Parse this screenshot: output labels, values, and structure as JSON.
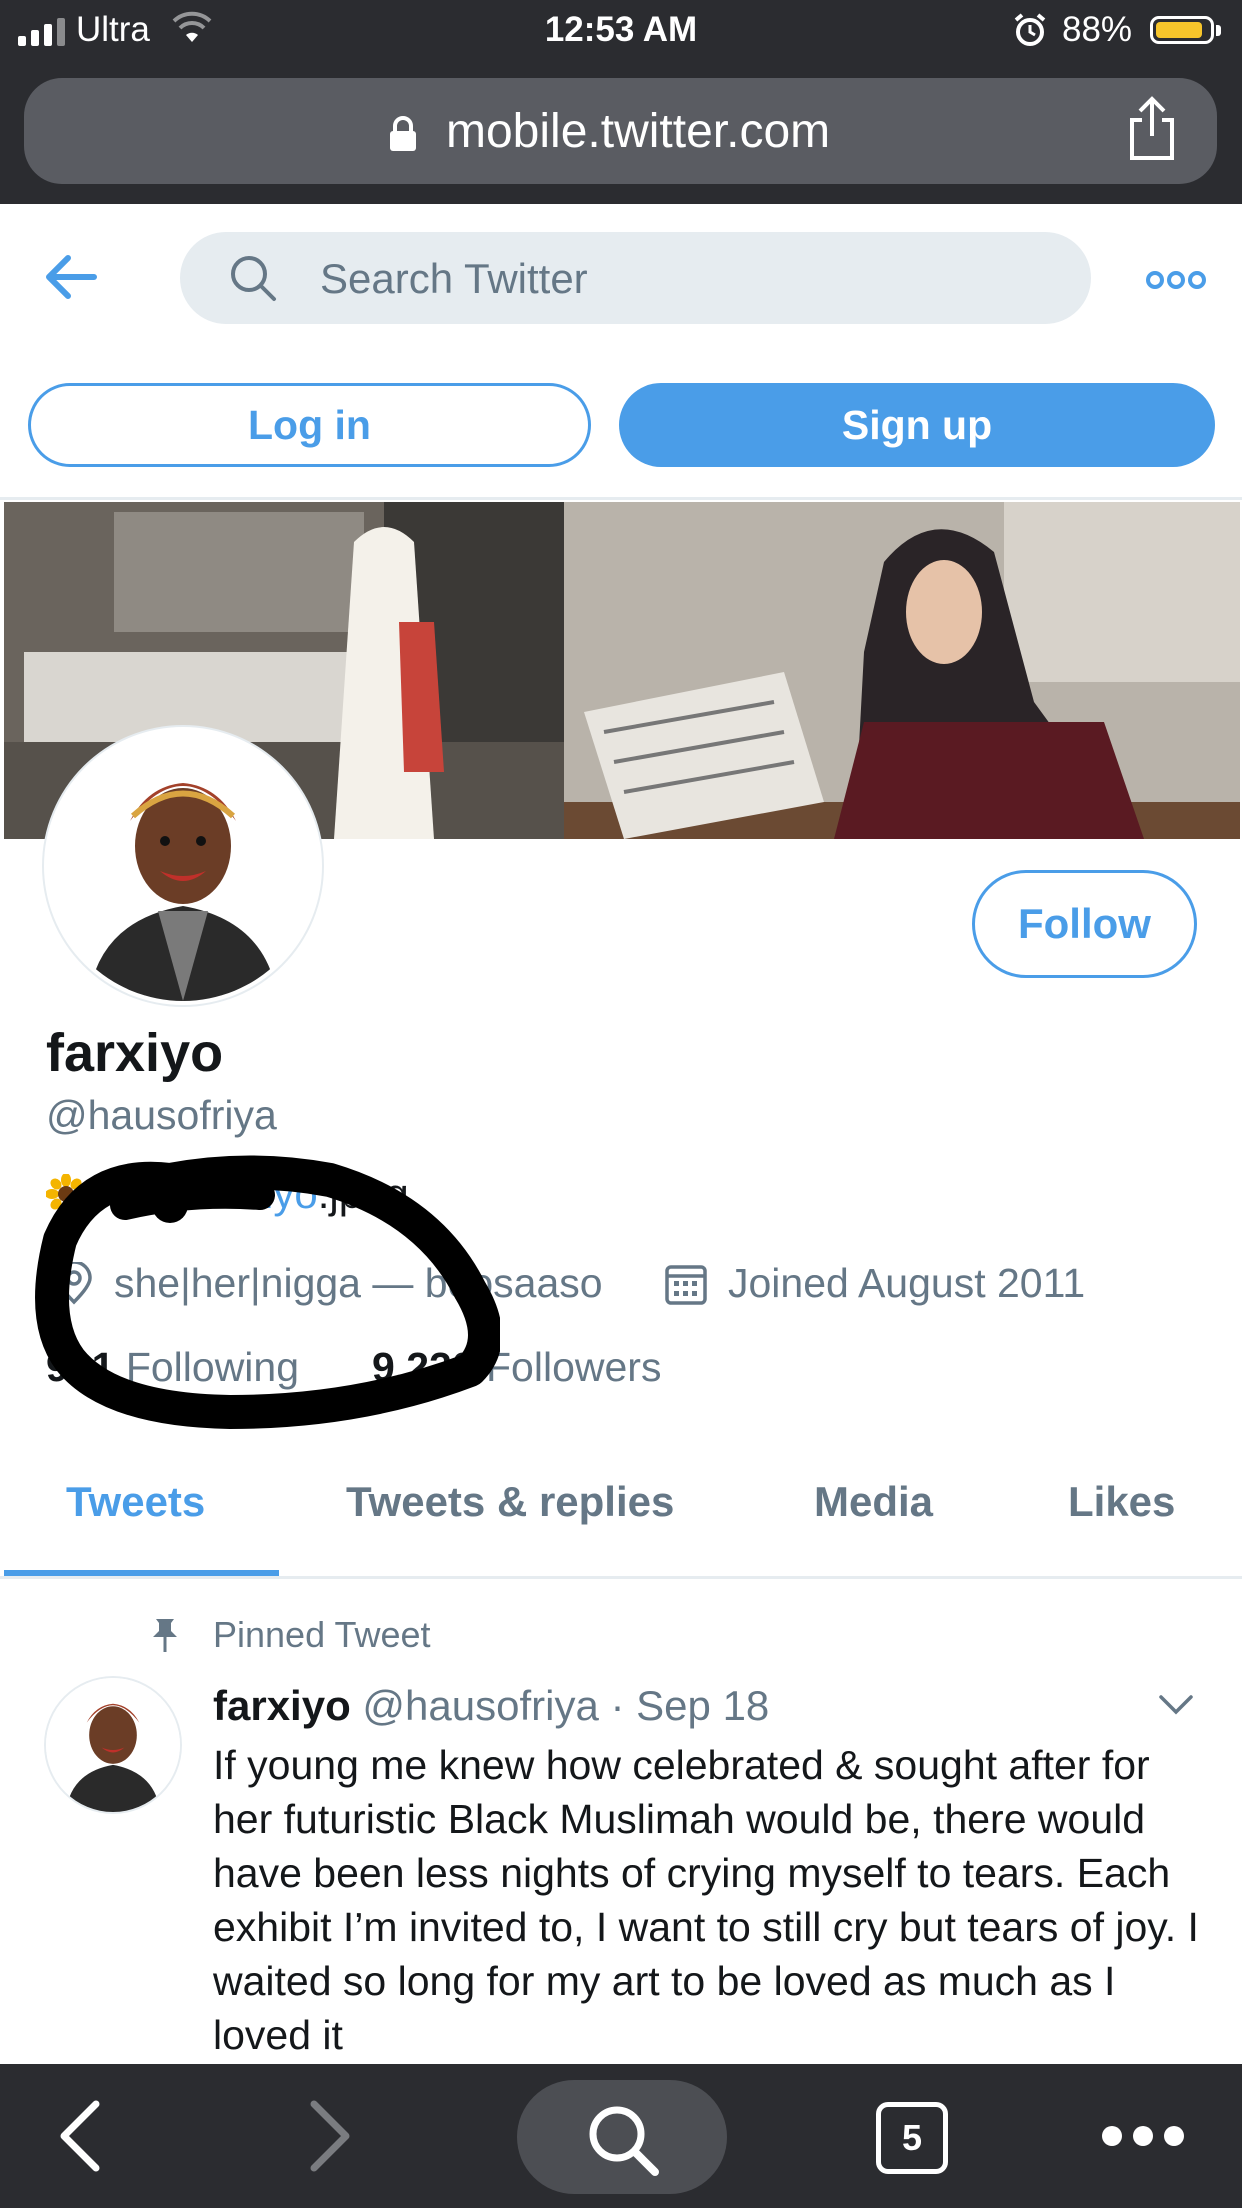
{
  "status_bar": {
    "carrier": "Ultra",
    "time": "12:53 AM",
    "battery_percent": "88%",
    "battery_level": 0.88,
    "battery_color": "#f7c52b"
  },
  "browser": {
    "url": "mobile.twitter.com",
    "open_tabs": "5"
  },
  "header": {
    "search_placeholder": "Search Twitter"
  },
  "auth": {
    "login_label": "Log in",
    "signup_label": "Sign up"
  },
  "profile": {
    "display_name": "farxiyo",
    "handle": "@hausofriya",
    "follow_label": "Follow",
    "bio": {
      "prefix": "— @",
      "link": "farxiyo",
      "suffix": ".jpeg"
    },
    "location": "she|her|nigga — boosaaso",
    "joined": "Joined August 2011",
    "following_count": "961",
    "following_label": "Following",
    "followers_count": "9,220",
    "followers_label": "Followers"
  },
  "tabs": [
    {
      "label": "Tweets",
      "active": true
    },
    {
      "label": "Tweets & replies",
      "active": false
    },
    {
      "label": "Media",
      "active": false
    },
    {
      "label": "Likes",
      "active": false
    }
  ],
  "pinned_tweet": {
    "pinned_label": "Pinned Tweet",
    "name": "farxiyo",
    "handle": "@hausofriya",
    "separator": "·",
    "date": "Sep 18",
    "text": "If young me knew how celebrated & sought after for her futuristic Black Muslimah would be, there would have been less nights of crying myself to tears. Each exhibit I’m invited to, I want to still cry but tears of joy. I waited so long for my art to be loved as much as I loved it"
  },
  "colors": {
    "twitter_blue": "#4a9de8",
    "secondary_text": "#657786",
    "primary_text": "#14171a",
    "browser_chrome": "#2b2c30"
  },
  "icons": [
    "signal-icon",
    "wifi-icon",
    "alarm-icon",
    "battery-icon",
    "lock-icon",
    "share-icon",
    "back-arrow-icon",
    "search-icon",
    "more-icon",
    "sunflower-icon",
    "location-icon",
    "calendar-icon",
    "pin-icon",
    "chevron-down-icon",
    "nav-back-icon",
    "nav-forward-icon",
    "tabs-icon",
    "more-dots-icon"
  ]
}
